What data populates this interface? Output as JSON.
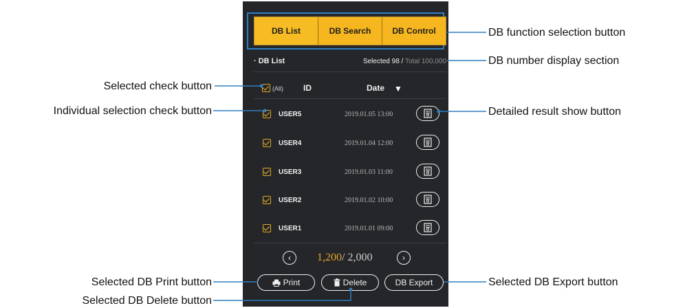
{
  "tabs": [
    {
      "label": "DB List",
      "active": true
    },
    {
      "label": "DB Search",
      "active": false
    },
    {
      "label": "DB Control",
      "active": false
    }
  ],
  "list": {
    "section_title": "· DB List",
    "selected_text": "Selected 98 / ",
    "total_text": "Total 100,000",
    "all_label": "(All)",
    "col_id": "ID",
    "col_date": "Date",
    "rows": [
      {
        "id": "USER5",
        "date": "2019.01.05  13:00"
      },
      {
        "id": "USER4",
        "date": "2019.01.04  12:00"
      },
      {
        "id": "USER3",
        "date": "2019.01.03  11:00"
      },
      {
        "id": "USER2",
        "date": "2019.01.02  10:00"
      },
      {
        "id": "USER1",
        "date": "2019.01.01  09:00"
      }
    ]
  },
  "pager": {
    "current": "1,200",
    "total": "/ 2,000"
  },
  "actions": {
    "print": "Print",
    "delete": "Delete",
    "export": "DB Export"
  },
  "callouts": {
    "function_select": "DB function selection button",
    "number_display": "DB number display section",
    "selected_check": "Selected check button",
    "individual_check": "Individual selection check button",
    "detailed_result": "Detailed result show button",
    "print": "Selected DB Print button",
    "export": "Selected DB Export button",
    "delete": "Selected DB Delete button"
  },
  "colors": {
    "accent": "#f6b61f",
    "panel": "#24262a",
    "callout_line": "#2f7fc1"
  },
  "icons": [
    "sort-down-icon",
    "document-search-icon",
    "chevron-left-icon",
    "chevron-right-icon",
    "printer-icon",
    "trash-icon"
  ]
}
